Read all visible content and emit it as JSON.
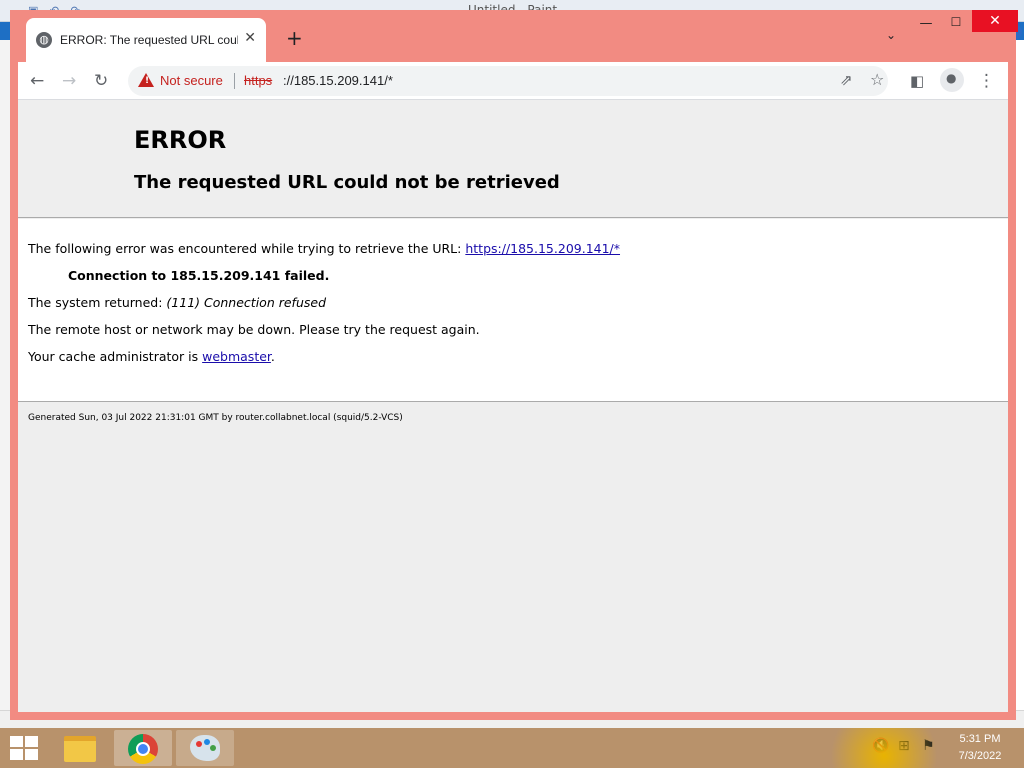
{
  "paint": {
    "window_title": "Untitled - Paint",
    "help_label": "?"
  },
  "browser": {
    "tab_title": "ERROR: The requested URL could not be retrieved",
    "new_tab_label": "+",
    "tab_search_label": "⌄",
    "close_tab_label": "✕",
    "window_minimize": "—",
    "window_maximize": "☐",
    "window_close": "✕",
    "security_label": "Not secure",
    "url_scheme": "https",
    "url_rest": "://185.15.209.141/*",
    "accent_color": "#f28b82"
  },
  "page": {
    "heading": "ERROR",
    "subheading": "The requested URL could not be retrieved",
    "line1_text": "The following error was encountered while trying to retrieve the URL: ",
    "line1_link": "https://185.15.209.141/*",
    "line2_bold": "Connection to 185.15.209.141 failed.",
    "line3_text": "The system returned: ",
    "line3_italic": "(111) Connection refused",
    "line4_text": "The remote host or network may be down. Please try the request again.",
    "line5_text": "Your cache administrator is ",
    "line5_link": "webmaster",
    "line5_end": ".",
    "footer": "Generated Sun, 03 Jul 2022 21:31:01 GMT by router.collabnet.local (squid/5.2-VCS)"
  },
  "taskbar": {
    "time": "5:31 PM",
    "date": "7/3/2022",
    "apps": [
      "file-explorer",
      "google-chrome",
      "paint"
    ]
  }
}
